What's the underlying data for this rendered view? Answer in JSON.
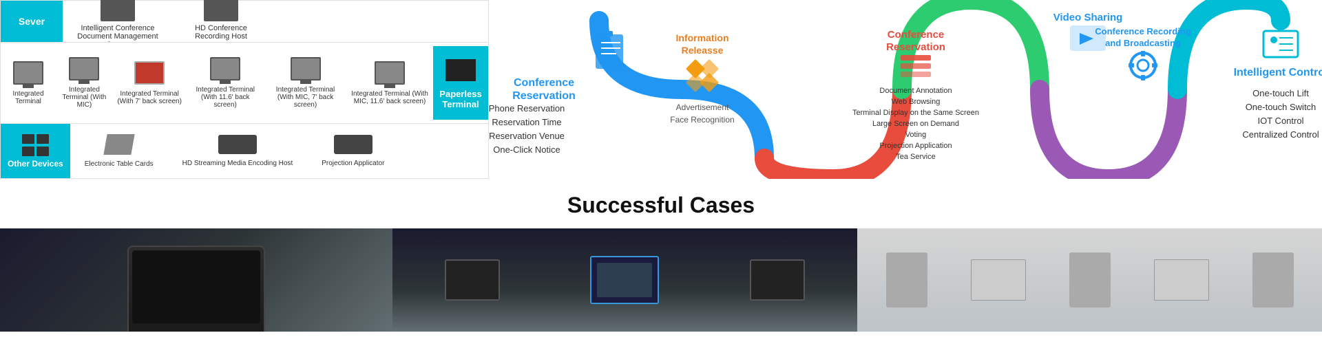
{
  "header": {
    "server_label": "Sever",
    "server_items": [
      "Intelligent Conference Document Management Server",
      "HD Conference Recording Host"
    ]
  },
  "devices": [
    {
      "id": "d1",
      "label": "Integrated Terminal",
      "type": "monitor"
    },
    {
      "id": "d2",
      "label": "Integrated Terminal (With MIC)",
      "type": "monitor"
    },
    {
      "id": "d3",
      "label": "Integrated Terminal (With 7' back screen)",
      "type": "monitor-red"
    },
    {
      "id": "d4",
      "label": "Integrated Terminal (With 11.6' back screen)",
      "type": "monitor"
    },
    {
      "id": "d5",
      "label": "Integrated Terminal (With MIC, 7' back screen)",
      "type": "monitor"
    },
    {
      "id": "d6",
      "label": "Integrated Terminal (With MIC, 11.6' back screen)",
      "type": "monitor"
    }
  ],
  "paperless_terminal": {
    "label": "Paperless Terminal"
  },
  "other_devices": {
    "label": "Other Devices",
    "items": [
      {
        "id": "od1",
        "label": "Electronic Table Cards",
        "type": "table-card"
      },
      {
        "id": "od2",
        "label": "HD Streaming Media Encoding Host",
        "type": "box"
      },
      {
        "id": "od3",
        "label": "Projection Applicator",
        "type": "box"
      }
    ]
  },
  "diagram": {
    "conference_reservation": {
      "title": "Conference Reservation",
      "items": [
        "Phone Reservation",
        "Reservation Time",
        "Reservation Venue",
        "One-Click Notice"
      ]
    },
    "information_release": {
      "title": "Information Releasse",
      "sub_items": [
        "Advertisement",
        "Face Recognition"
      ]
    },
    "conference_reservation_center": {
      "title": "Conference Reservation",
      "sub_items": [
        "Document Annotation",
        "Web Browsing",
        "Terminal Display on the Same Screen",
        "Large Screen on Demand",
        "Voting",
        "Projection Application",
        "Tea Service"
      ]
    },
    "video_sharing": {
      "title": "Video Sharing"
    },
    "conference_recording": {
      "title": "Conference Recording and Broadcasting"
    },
    "intelligent_control": {
      "title": "Intelligent Control",
      "items": [
        "One-touch Lift",
        "One-touch Switch",
        "IOT Control",
        "Centralized Control"
      ]
    }
  },
  "cases": {
    "title": "Successful Cases"
  }
}
